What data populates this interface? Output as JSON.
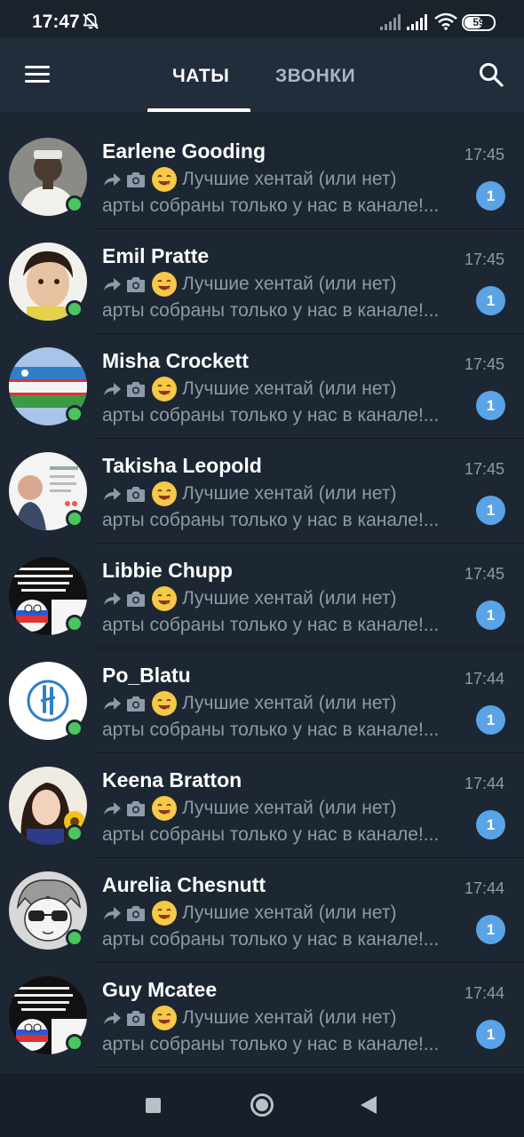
{
  "status_bar": {
    "time": "17:47",
    "battery": "59",
    "battery_level": 0.59,
    "icons": [
      "bell-off-icon",
      "signal-icon",
      "signal-icon",
      "wifi-icon",
      "battery-icon"
    ]
  },
  "header": {
    "menu_icon": "menu-icon",
    "tabs": [
      {
        "label": "ЧАТЫ",
        "active": true
      },
      {
        "label": "ЗВОНКИ",
        "active": false
      }
    ],
    "search_icon": "search-icon"
  },
  "chats": [
    {
      "name": "Earlene Gooding",
      "time": "17:45",
      "preview_line1": "Лучшие хентай (или нет)",
      "preview_line2": "арты собраны только у нас в канале!...",
      "unread": "1",
      "avatar": "portrait-dark"
    },
    {
      "name": "Emil Pratte",
      "time": "17:45",
      "preview_line1": "Лучшие хентай (или нет)",
      "preview_line2": "арты собраны только у нас в канале!...",
      "unread": "1",
      "avatar": "child-photo"
    },
    {
      "name": "Misha Crockett",
      "time": "17:45",
      "preview_line1": "Лучшие хентай (или нет)",
      "preview_line2": "арты собраны только у нас в канале!...",
      "unread": "1",
      "avatar": "uzbekistan-flag"
    },
    {
      "name": "Takisha Leopold",
      "time": "17:45",
      "preview_line1": "Лучшие хентай (или нет)",
      "preview_line2": "арты собраны только у нас в канале!...",
      "unread": "1",
      "avatar": "screenshot-man"
    },
    {
      "name": "Libbie Chupp",
      "time": "17:45",
      "preview_line1": "Лучшие хентай (или нет)",
      "preview_line2": "арты собраны только у нас в канале!...",
      "unread": "1",
      "avatar": "meme-russia"
    },
    {
      "name": "Po_Blatu",
      "time": "17:44",
      "preview_line1": "Лучшие хентай (или нет)",
      "preview_line2": "арты собраны только у нас в канале!...",
      "unread": "1",
      "avatar": "blue-logo"
    },
    {
      "name": "Keena Bratton",
      "time": "17:44",
      "preview_line1": "Лучшие хентай (или нет)",
      "preview_line2": "арты собраны только у нас в канале!...",
      "unread": "1",
      "avatar": "girl-sunflower"
    },
    {
      "name": "Aurelia Chesnutt",
      "time": "17:44",
      "preview_line1": "Лучшие хентай (или нет)",
      "preview_line2": "арты собраны только у нас в канале!...",
      "unread": "1",
      "avatar": "anime-sunglasses"
    },
    {
      "name": "Guy Mcatee",
      "time": "17:44",
      "preview_line1": "Лучшие хентай (или нет)",
      "preview_line2": "арты собраны только у нас в канале!...",
      "unread": "1",
      "avatar": "meme-russia"
    }
  ],
  "nav_bar": {
    "buttons": [
      "recents-square-icon",
      "home-circle-icon",
      "back-triangle-icon"
    ]
  },
  "colors": {
    "background": "#1d2733",
    "header": "#212d3b",
    "accent_badge": "#5aa3e6",
    "online": "#4bc65f",
    "secondary_text": "#8e9aa7"
  }
}
